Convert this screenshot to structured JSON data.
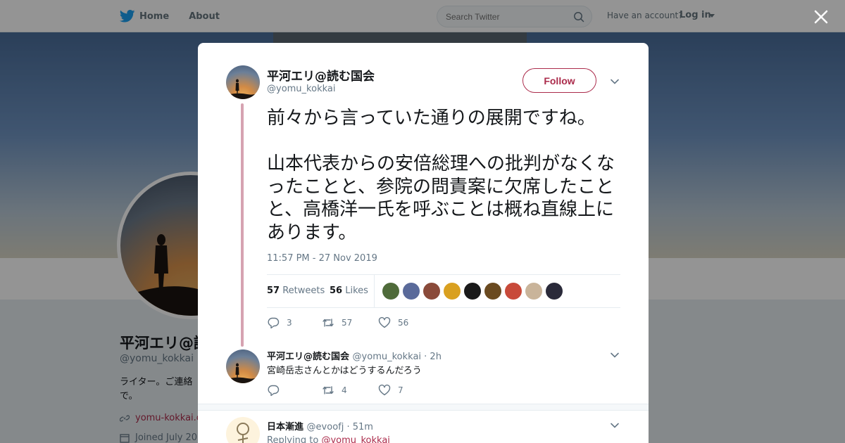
{
  "nav": {
    "home_label": "Home",
    "about_label": "About",
    "search_placeholder": "Search Twitter",
    "have_account": "Have an account?",
    "login_label": "Log in"
  },
  "profile": {
    "name": "平河エリ@読",
    "handle": "@yomu_kokkai",
    "bio": "ライター。ご連絡で。",
    "link": "yomu-kokkai.c",
    "joined": "Joined July 20"
  },
  "tweet": {
    "name": "平河エリ@読む国会",
    "handle": "@yomu_kokkai",
    "follow_label": "Follow",
    "text": "前々から言っていた通りの展開ですね。\n\n山本代表からの安倍総理への批判がなくなったことと、参院の問責案に欠席したことと、高橋洋一氏を呼ぶことは概ね直線上にあります。",
    "timestamp": "11:57 PM - 27 Nov 2019",
    "retweets_count": "57",
    "retweets_label": "Retweets",
    "likes_count": "56",
    "likes_label": "Likes",
    "reply_count": "3",
    "retweet_action_count": "57",
    "like_action_count": "56",
    "likers_colors": [
      "#4f6b3a",
      "#5a6a9a",
      "#8a4a3a",
      "#d9a020",
      "#1a1a1a",
      "#6a4a20",
      "#c84a3a",
      "#c9b49a",
      "#2a2a3a"
    ]
  },
  "reply1": {
    "name": "平河エリ@読む国会",
    "meta": "@yomu_kokkai · 2h",
    "text": "宮崎岳志さんとかはどうするんだろう",
    "retweet_count": "4",
    "like_count": "7"
  },
  "reply2": {
    "name": "日本漸進",
    "meta": "@evoofj · 51m",
    "replying_prefix": "Replying to",
    "replying_handle": "@yomu_kokkai"
  },
  "colors": {
    "accent": "#ab2b4b",
    "thread_line": "#d6a3b1",
    "twitter_blue": "#1da1f2"
  }
}
